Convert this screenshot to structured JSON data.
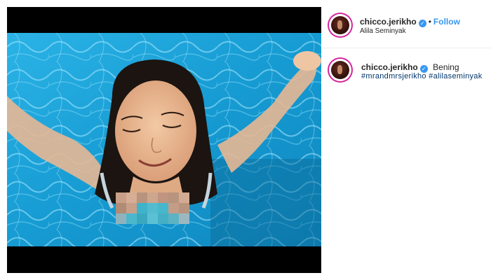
{
  "post": {
    "username": "chicco.jerikho",
    "location": "Alila Seminyak",
    "follow_label": "Follow",
    "separator": "•",
    "verified_glyph": "✓",
    "image_alt": "Woman smiling in swimming pool",
    "censored": true
  },
  "caption": {
    "username": "chicco.jerikho",
    "text": "Bening",
    "hashtags": "#mrandmrsjerikho #alilaseminyak"
  },
  "colors": {
    "link_blue": "#3897f0",
    "hashtag_blue": "#003569",
    "pool_blue": "#1aa0d8",
    "avatar_ring": "#d6249f"
  },
  "icons": {
    "verified": "verified-badge-icon",
    "avatar": "profile-avatar"
  }
}
